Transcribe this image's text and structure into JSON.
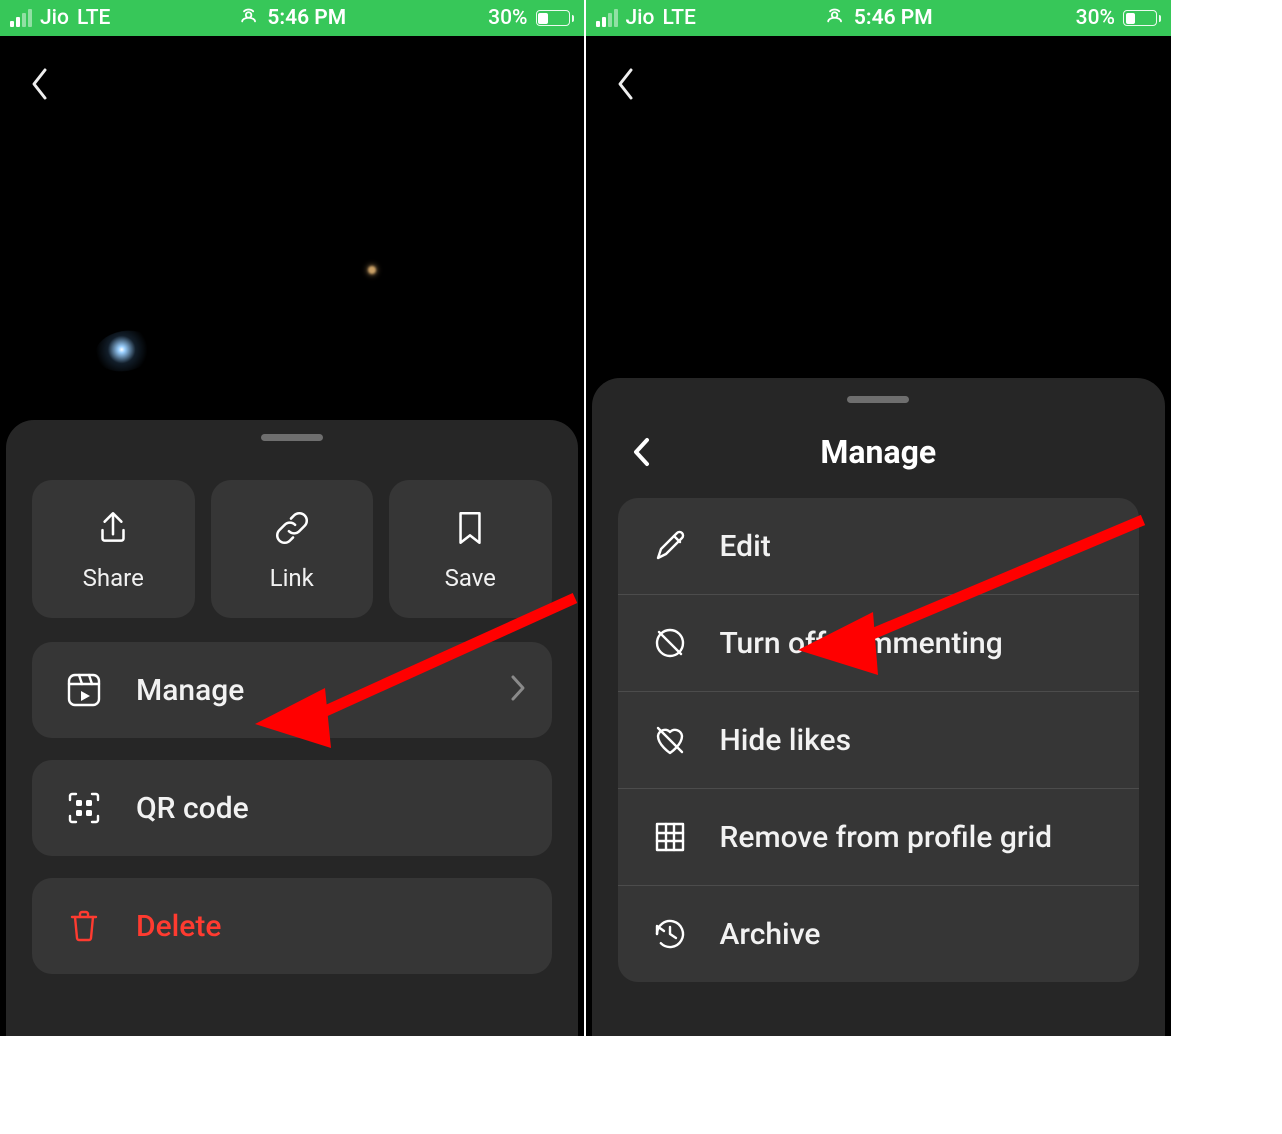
{
  "status": {
    "carrier": "Jio",
    "network": "LTE",
    "time": "5:46 PM",
    "battery_pct": "30%",
    "battery_fill": 30
  },
  "left_sheet": {
    "buttons": {
      "share": "Share",
      "link": "Link",
      "save": "Save"
    },
    "rows": {
      "manage": "Manage",
      "qr": "QR code",
      "delete": "Delete"
    }
  },
  "right_sheet": {
    "title": "Manage",
    "items": {
      "edit": "Edit",
      "turn_off": "Turn off commenting",
      "hide_likes": "Hide likes",
      "remove_grid": "Remove from profile grid",
      "archive": "Archive"
    }
  }
}
